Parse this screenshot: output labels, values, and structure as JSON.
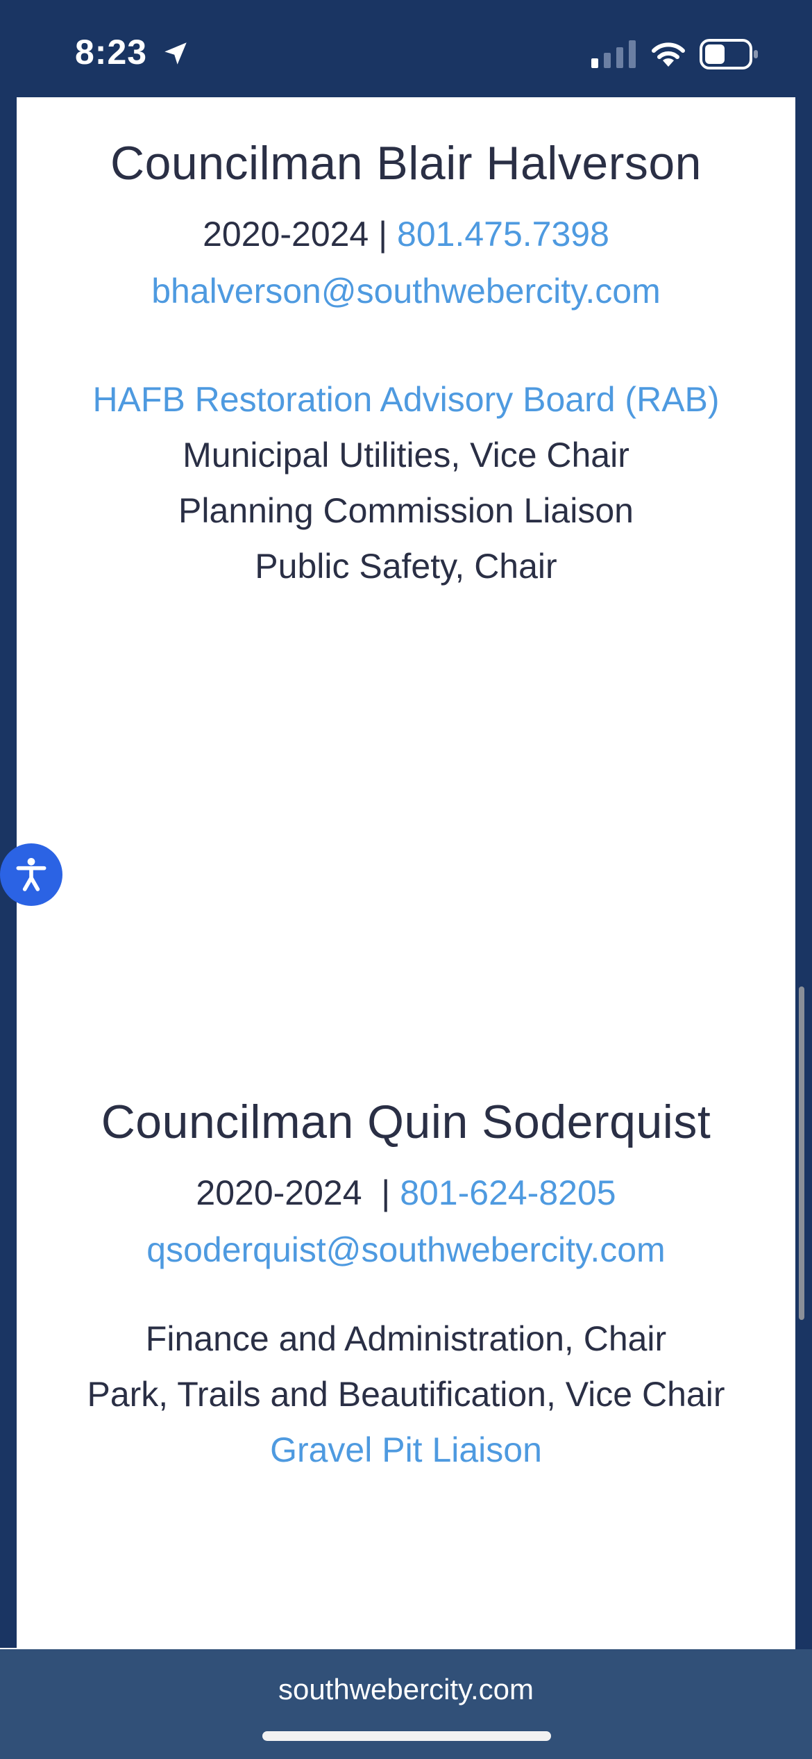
{
  "status_bar": {
    "time": "8:23"
  },
  "councilmen": [
    {
      "name": "Councilman Blair Halverson",
      "term": "2020-2024 | ",
      "phone": "801.475.7398",
      "email": "bhalverson@southwebercity.com",
      "roles": [
        "HAFB Restoration Advisory Board (RAB)",
        "Municipal Utilities, Vice Chair",
        "Planning Commission Liaison",
        "Public Safety, Chair"
      ]
    },
    {
      "name": "Councilman Quin Soderquist",
      "term": "2020-2024  | ",
      "phone": "801-624-8205",
      "email": "qsoderquist@southwebercity.com",
      "roles": [
        "Finance and Administration, Chair",
        "Park, Trails and Beautification, Vice Chair",
        "Gravel Pit Liaison"
      ]
    }
  ],
  "browser": {
    "url": "southwebercity.com"
  },
  "colors": {
    "header_bg": "#1a3563",
    "link": "#4e9ae0",
    "text": "#2a2f45",
    "url_bar_bg": "#315078",
    "accessibility_button": "#2b63e4"
  }
}
